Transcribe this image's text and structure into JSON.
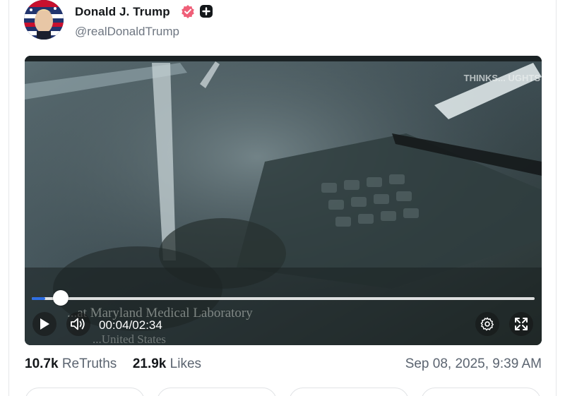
{
  "post": {
    "author": {
      "display_name": "Donald J. Trump",
      "handle": "@realDonaldTrump",
      "verified_color": "#ef5f78"
    },
    "video": {
      "watermark": "THINKS... UGHTS",
      "caption_line": "...at Maryland Medical Laboratory",
      "caption_line2": "...United States",
      "current_time": "00:04",
      "duration": "02:34",
      "progress": 0.026,
      "time_separator": "/"
    },
    "stats": {
      "retruths_count": "10.7k",
      "retruths_label": "ReTruths",
      "likes_count": "21.9k",
      "likes_label": "Likes"
    },
    "timestamp": "Sep 08, 2025, 9:39 AM"
  },
  "colors": {
    "accent": "#2f6fe4",
    "muted_text": "#5b6470"
  }
}
